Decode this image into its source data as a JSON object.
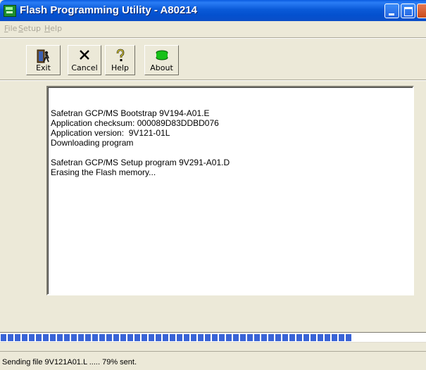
{
  "window": {
    "title": "Flash Programming Utility - A80214"
  },
  "menu": [
    {
      "first": "F",
      "rest": "ile"
    },
    {
      "first": "S",
      "rest": "etup"
    },
    {
      "first": "H",
      "rest": "elp"
    }
  ],
  "toolbar": {
    "exit_label": "Exit",
    "cancel_label": "Cancel",
    "help_label": "Help",
    "about_label": "About"
  },
  "log": {
    "lines": [
      "Safetran GCP/MS Bootstrap 9V194-A01.E",
      "Application checksum: 000089D83DDBD076",
      "Application version:  9V121-01L",
      "Downloading program",
      "",
      "Safetran GCP/MS Setup program 9V291-A01.D",
      "Erasing the Flash memory..."
    ]
  },
  "progress": {
    "fraction": 0.845,
    "color": "#3a64d6"
  },
  "status": {
    "text": "Sending file 9V121A01.L ..... 79% sent."
  },
  "icons": [
    "app-icon",
    "exit-icon",
    "cancel-icon",
    "help-icon",
    "about-icon"
  ]
}
